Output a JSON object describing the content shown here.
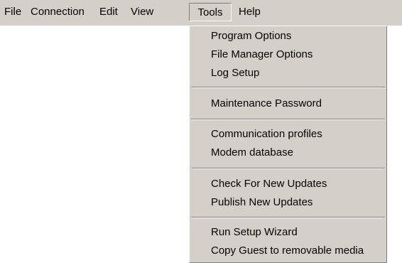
{
  "menubar": {
    "items": [
      "File",
      "Connection",
      "Edit",
      "View",
      "Tools",
      "Help"
    ],
    "active": "Tools"
  },
  "tools_menu": {
    "groups": [
      [
        "Program Options",
        "File Manager Options",
        "Log Setup"
      ],
      [
        "Maintenance Password"
      ],
      [
        "Communication profiles",
        "Modem database"
      ],
      [
        "Check For New Updates",
        "Publish New Updates"
      ],
      [
        "Run Setup Wizard",
        "Copy Guest to removable media"
      ]
    ]
  },
  "colors": {
    "menu_face": "#d4d0c8",
    "shadow": "#808080",
    "highlight": "#ffffff",
    "text": "#000000"
  }
}
